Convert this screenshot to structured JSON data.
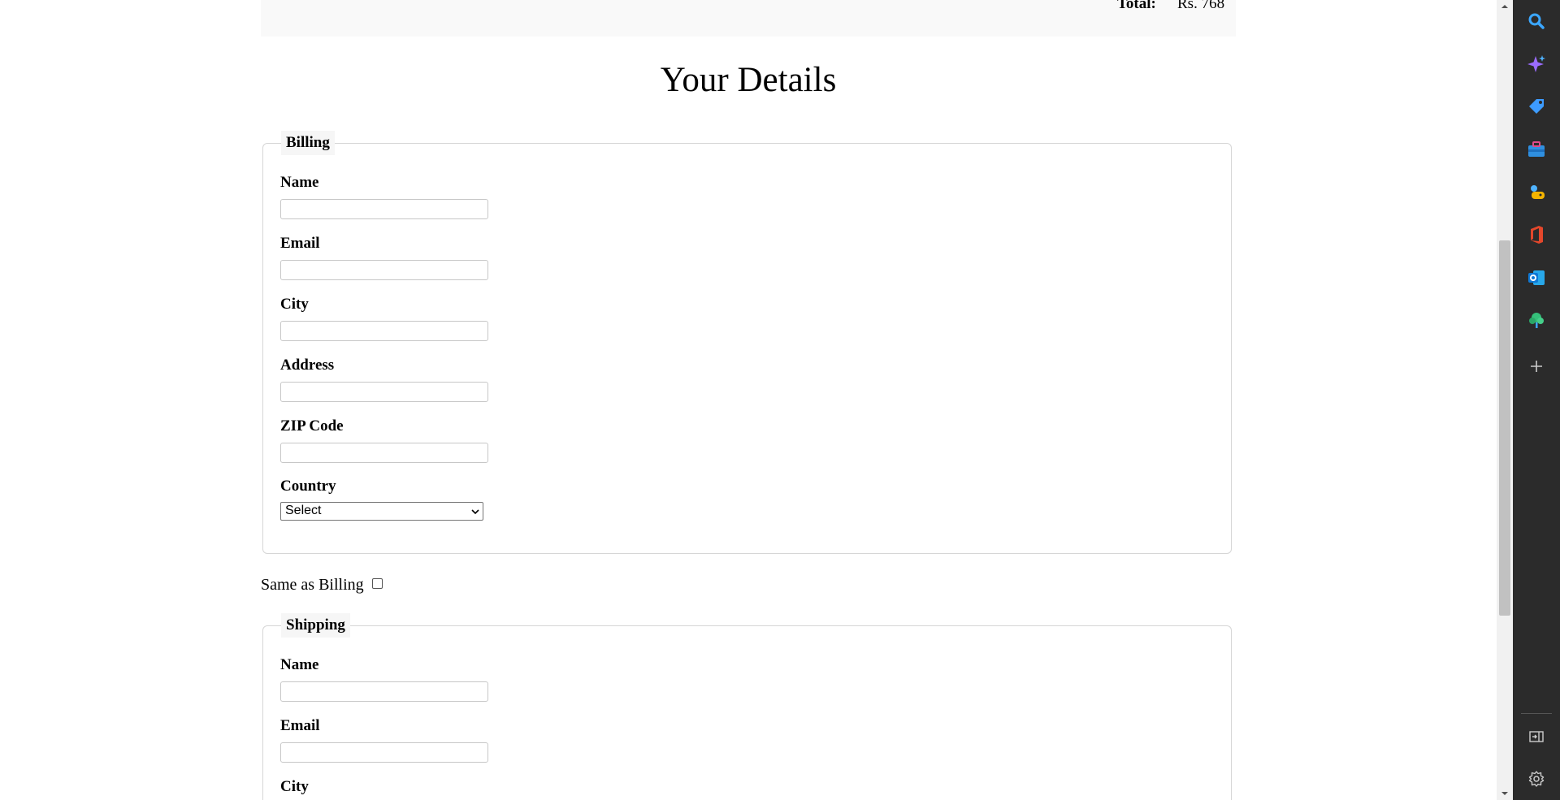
{
  "summary": {
    "total_label": "Total:",
    "total_value": "Rs. 768"
  },
  "page_title": "Your Details",
  "billing": {
    "legend": "Billing",
    "fields": [
      {
        "label": "Name",
        "value": ""
      },
      {
        "label": "Email",
        "value": ""
      },
      {
        "label": "City",
        "value": ""
      },
      {
        "label": "Address",
        "value": ""
      },
      {
        "label": "ZIP Code",
        "value": ""
      }
    ],
    "country_label": "Country",
    "country_selected": "Select"
  },
  "same_as_billing": {
    "label": "Same as Billing",
    "checked": false
  },
  "shipping": {
    "legend": "Shipping",
    "fields": [
      {
        "label": "Name",
        "value": ""
      },
      {
        "label": "Email",
        "value": ""
      },
      {
        "label": "City",
        "value": ""
      }
    ]
  },
  "sidebar_icons": [
    "search-icon",
    "copilot-icon",
    "shopping-tag-icon",
    "tools-icon",
    "games-icon",
    "office-icon",
    "outlook-icon",
    "tree-icon",
    "add-icon",
    "split-screen-icon",
    "settings-icon"
  ],
  "colors": {
    "sidebar_bg": "#2b2b2b",
    "search_blue": "#3ba7ff",
    "office_red": "#e4472b",
    "outlook_blue": "#0f78d4"
  }
}
